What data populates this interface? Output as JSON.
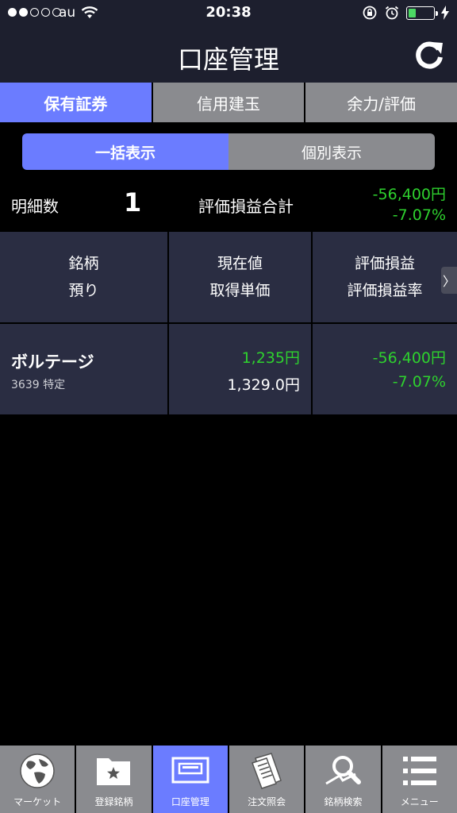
{
  "status": {
    "carrier": "au",
    "time": "20:38",
    "battery_level": 0.3
  },
  "nav": {
    "title": "口座管理"
  },
  "tabs": [
    {
      "label": "保有証券",
      "active": true
    },
    {
      "label": "信用建玉",
      "active": false
    },
    {
      "label": "余力/評価",
      "active": false
    }
  ],
  "subtabs": [
    {
      "label": "一括表示",
      "active": true
    },
    {
      "label": "個別表示",
      "active": false
    }
  ],
  "summary": {
    "count_label": "明細数",
    "count": "1",
    "total_label": "評価損益合計",
    "total_amount": "-56,400円",
    "total_rate": "-7.07%"
  },
  "table": {
    "headers": [
      {
        "line1": "銘柄",
        "line2": "預り"
      },
      {
        "line1": "現在値",
        "line2": "取得単価"
      },
      {
        "line1": "評価損益",
        "line2": "評価損益率"
      }
    ],
    "scroll_arrow": "〉",
    "rows": [
      {
        "name": "ボルテージ",
        "sub": "3639 特定",
        "current_price": "1,235円",
        "acquisition_price": "1,329.0円",
        "pl_amount": "-56,400円",
        "pl_rate": "-7.07%"
      }
    ]
  },
  "tabbar": [
    {
      "label": "マーケット",
      "icon": "globe-icon",
      "active": false
    },
    {
      "label": "登録銘柄",
      "icon": "folder-star-icon",
      "active": false
    },
    {
      "label": "口座管理",
      "icon": "account-icon",
      "active": true
    },
    {
      "label": "注文照会",
      "icon": "document-icon",
      "active": false
    },
    {
      "label": "銘柄検索",
      "icon": "search-icon",
      "active": false
    },
    {
      "label": "メニュー",
      "icon": "menu-icon",
      "active": false
    }
  ],
  "colors": {
    "accent": "#6b7cff",
    "positive_green": "#2ed12e",
    "panel": "#2a2d42",
    "bar": "#1d1f2e"
  }
}
